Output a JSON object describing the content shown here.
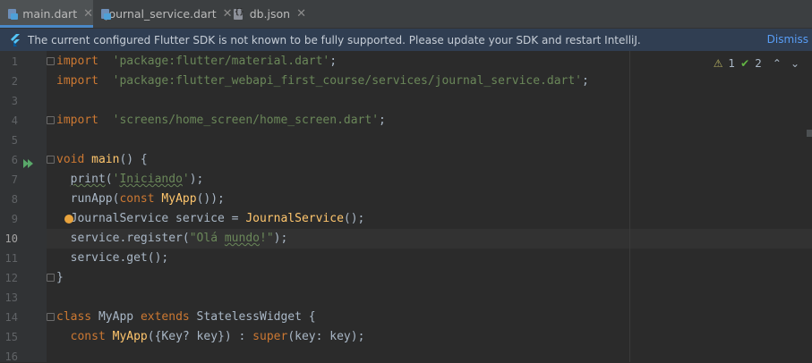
{
  "tabs": [
    {
      "label": "main.dart",
      "icon": "dart-file-icon",
      "active": true
    },
    {
      "label": "journal_service.dart",
      "icon": "dart-file-icon",
      "active": false
    },
    {
      "label": "db.json",
      "icon": "json-file-icon",
      "active": false
    }
  ],
  "banner": {
    "message": "The current configured Flutter SDK is not known to be fully supported. Please update your SDK and restart IntelliJ.",
    "dismiss_label": "Dismiss"
  },
  "inspections": {
    "warnings": "1",
    "ok": "2"
  },
  "current_line": 10,
  "lines": [
    {
      "n": "1",
      "parts": [
        [
          "kw",
          "import"
        ],
        [
          "",
          "  "
        ],
        [
          "str",
          "'package:flutter/material.dart'"
        ],
        [
          "",
          ";"
        ]
      ]
    },
    {
      "n": "2",
      "parts": [
        [
          "kw",
          "import"
        ],
        [
          "",
          "  "
        ],
        [
          "str",
          "'package:flutter_webapi_first_course/services/journal_service.dart'"
        ],
        [
          "",
          ";"
        ]
      ]
    },
    {
      "n": "3",
      "parts": []
    },
    {
      "n": "4",
      "parts": [
        [
          "kw",
          "import"
        ],
        [
          "",
          "  "
        ],
        [
          "str",
          "'screens/home_screen/home_screen.dart'"
        ],
        [
          "",
          ";"
        ]
      ]
    },
    {
      "n": "5",
      "parts": []
    },
    {
      "n": "6",
      "parts": [
        [
          "kw",
          "void"
        ],
        [
          "",
          " "
        ],
        [
          "cls",
          "main"
        ],
        [
          "",
          "() {"
        ]
      ]
    },
    {
      "n": "7",
      "parts": [
        [
          "",
          "  "
        ],
        [
          "squig-plain",
          "print"
        ],
        [
          "",
          "("
        ],
        [
          "str",
          "'"
        ],
        [
          "str-squig",
          "Iniciando"
        ],
        [
          "str",
          "'"
        ],
        [
          "",
          ");"
        ]
      ]
    },
    {
      "n": "8",
      "parts": [
        [
          "",
          "  runApp("
        ],
        [
          "kw",
          "const"
        ],
        [
          "",
          " "
        ],
        [
          "cls",
          "MyApp"
        ],
        [
          "",
          "());"
        ]
      ]
    },
    {
      "n": "9",
      "parts": [
        [
          "",
          "  JournalService service = "
        ],
        [
          "cls",
          "JournalService"
        ],
        [
          "",
          "();"
        ]
      ]
    },
    {
      "n": "10",
      "parts": [
        [
          "",
          "  service.register("
        ],
        [
          "str",
          "\"Olá "
        ],
        [
          "str-squig",
          "mundo"
        ],
        [
          "str",
          "!\""
        ],
        [
          "",
          ");"
        ]
      ]
    },
    {
      "n": "11",
      "parts": [
        [
          "",
          "  service.get();"
        ]
      ]
    },
    {
      "n": "12",
      "parts": [
        [
          "",
          "}"
        ]
      ]
    },
    {
      "n": "13",
      "parts": []
    },
    {
      "n": "14",
      "parts": [
        [
          "kw",
          "class"
        ],
        [
          "",
          " MyApp "
        ],
        [
          "kw",
          "extends"
        ],
        [
          "",
          " StatelessWidget {"
        ]
      ]
    },
    {
      "n": "15",
      "parts": [
        [
          "",
          "  "
        ],
        [
          "kw",
          "const"
        ],
        [
          "",
          " "
        ],
        [
          "cls",
          "MyApp"
        ],
        [
          "",
          "({Key? key}) : "
        ],
        [
          "kw",
          "super"
        ],
        [
          "",
          "(key: key);"
        ]
      ]
    },
    {
      "n": "16",
      "parts": []
    }
  ]
}
